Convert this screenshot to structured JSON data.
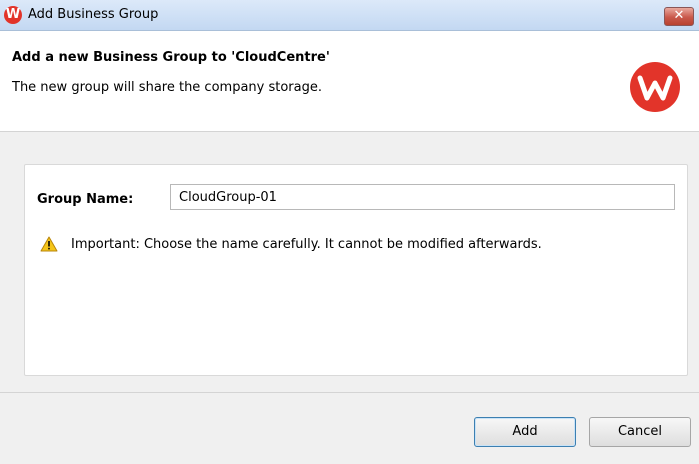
{
  "window": {
    "title": "Add Business Group",
    "logo_letter": "W",
    "close_label": "✕"
  },
  "header": {
    "title": "Add a new Business Group to 'CloudCentre'",
    "subtitle": "The new group will share the company storage.",
    "logo_letter": "W"
  },
  "form": {
    "group_name_label": "Group Name:",
    "group_name_value": "CloudGroup-01",
    "warning_text": "Important: Choose the name carefully. It cannot be modified afterwards."
  },
  "buttons": {
    "add_label": "Add",
    "cancel_label": "Cancel"
  },
  "colors": {
    "brand_red": "#e2342a",
    "warning_yellow": "#f5c518"
  }
}
